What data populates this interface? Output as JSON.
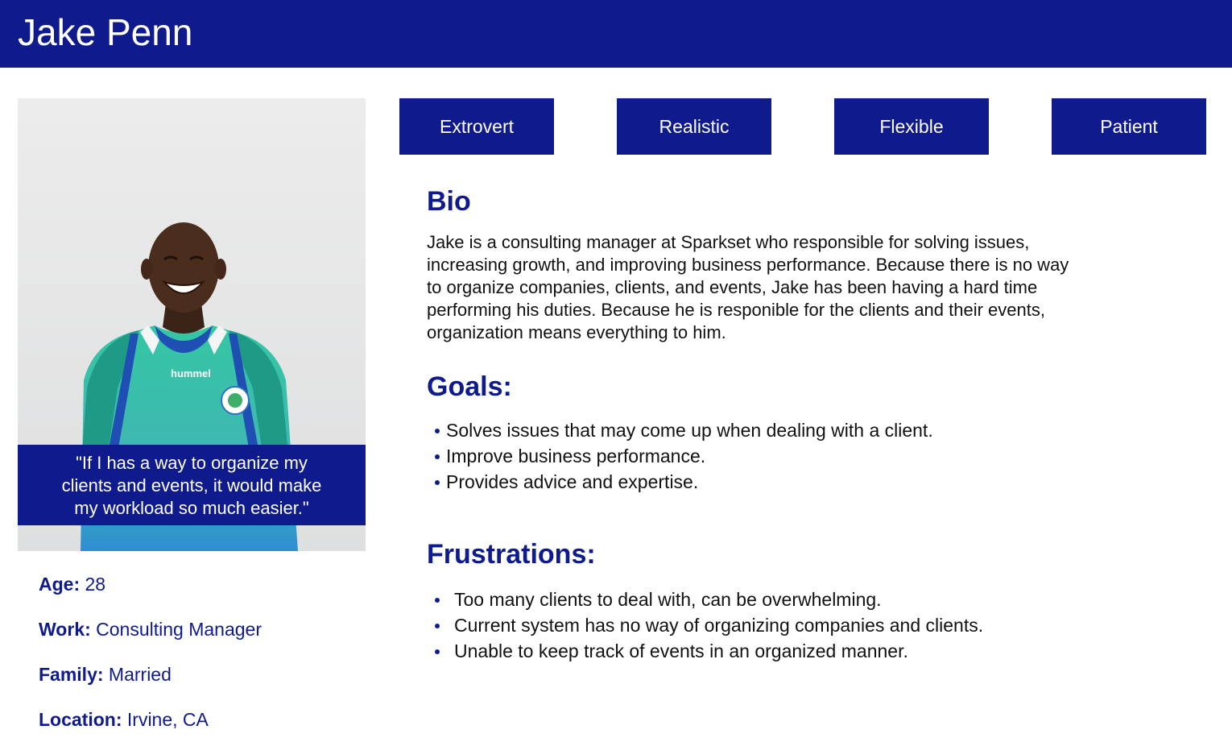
{
  "persona": {
    "name": "Jake Penn",
    "quote": "\"If I has a way to organize my clients and events, it would make my workload so much easier.\""
  },
  "traits": [
    "Extrovert",
    "Realistic",
    "Flexible",
    "Patient"
  ],
  "facts": [
    {
      "label": "Age:",
      "value": "28"
    },
    {
      "label": "Work:",
      "value": "Consulting Manager"
    },
    {
      "label": "Family:",
      "value": "Married"
    },
    {
      "label": "Location:",
      "value": "Irvine, CA"
    }
  ],
  "bio": {
    "heading": "Bio",
    "text": "Jake is a consulting manager at Sparkset who responsible for solving issues, increasing growth, and improving business performance. Because there is no way to organize companies, clients, and events, Jake has been having a hard time performing his duties. Because he is responible for the clients and their events, organization means everything to him."
  },
  "goals": {
    "heading": "Goals:",
    "items": [
      "Solves issues that may come up when dealing with a client.",
      "Improve business performance.",
      "Provides advice and expertise."
    ]
  },
  "frustrations": {
    "heading": "Frustrations:",
    "items": [
      "Too many clients to deal with, can be overwhelming.",
      "Current system has no way of organizing companies and clients.",
      "Unable to keep track of events in an organized manner."
    ]
  },
  "colors": {
    "brand": "#0f1b8c",
    "text": "#111111",
    "background": "#ffffff"
  },
  "photo": {
    "shirt_logo": "hummel"
  }
}
